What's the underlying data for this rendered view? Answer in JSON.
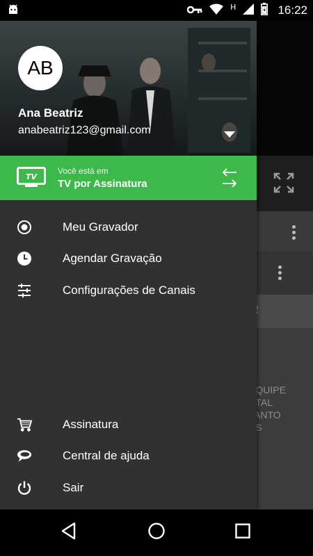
{
  "status_bar": {
    "time": "16:22",
    "network_letter": "H",
    "icons": [
      "android-debug-icon",
      "key-icon",
      "wifi-icon",
      "cell-signal-icon",
      "battery-icon"
    ]
  },
  "user": {
    "initials": "AB",
    "name": "Ana Beatriz",
    "email": "anabeatriz123@gmail.com"
  },
  "mode_bar": {
    "caption": "Você está em",
    "value": "TV por Assinatura",
    "tv_icon_text": "TV",
    "color": "#3cb94a"
  },
  "menu_top": [
    {
      "label": "Meu Gravador",
      "icon": "record-icon"
    },
    {
      "label": "Agendar Gravação",
      "icon": "clock-icon"
    },
    {
      "label": "Configurações de Canais",
      "icon": "sliders-icon"
    }
  ],
  "menu_bottom": [
    {
      "label": "Assinatura",
      "icon": "cart-icon"
    },
    {
      "label": "Central de ajuda",
      "icon": "chat-icon"
    },
    {
      "label": "Sair",
      "icon": "power-icon"
    }
  ],
  "background": {
    "tab_partial": "R",
    "text_partial": "EQUIPE\nSTAL\nJANTO\nAS"
  },
  "navbar": {
    "buttons": [
      "back-icon",
      "home-icon",
      "recents-icon"
    ]
  }
}
